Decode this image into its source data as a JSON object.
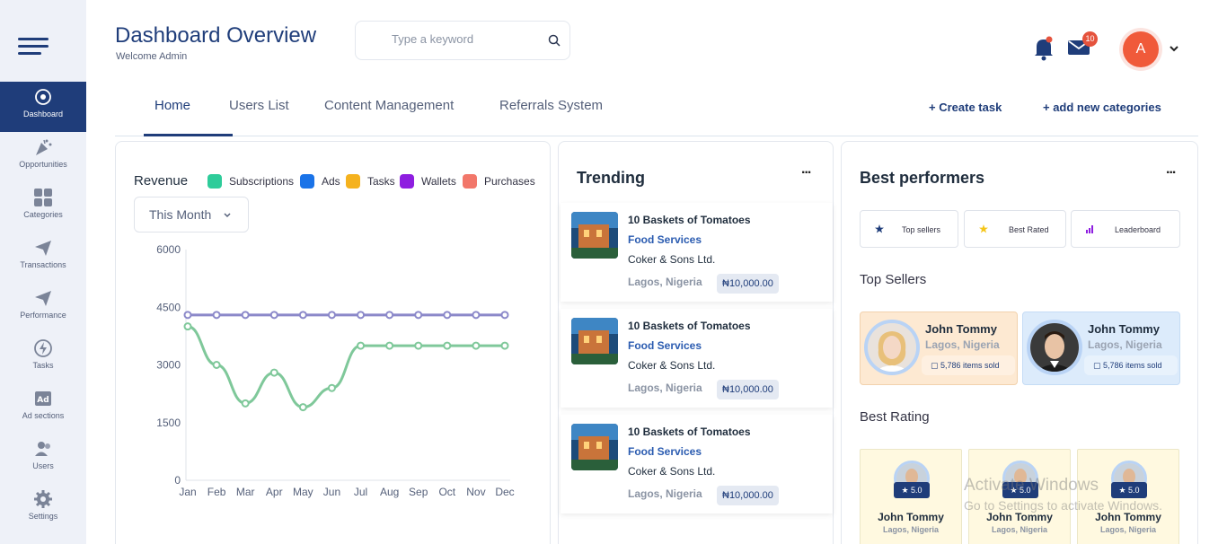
{
  "header": {
    "title": "Dashboard Overview",
    "subtitle": "Welcome Admin"
  },
  "search": {
    "placeholder": "Type a keyword"
  },
  "notifications": {
    "mail_count": "10"
  },
  "user": {
    "initial": "A"
  },
  "sidebar": {
    "items": [
      {
        "label": "Dashboard",
        "icon": "target-icon",
        "active": true
      },
      {
        "label": "Opportunities",
        "icon": "party-popper-icon"
      },
      {
        "label": "Categories",
        "icon": "grid-icon"
      },
      {
        "label": "Transactions",
        "icon": "send-icon"
      },
      {
        "label": "Performance",
        "icon": "send-icon"
      },
      {
        "label": "Tasks",
        "icon": "lightning-icon"
      },
      {
        "label": "Ad sections",
        "icon": "ad-icon"
      },
      {
        "label": "Users",
        "icon": "users-icon"
      },
      {
        "label": "Settings",
        "icon": "gear-icon"
      }
    ]
  },
  "tabs": [
    {
      "label": "Home",
      "active": true
    },
    {
      "label": "Users List"
    },
    {
      "label": "Content Management"
    },
    {
      "label": "Referrals System"
    }
  ],
  "actions": {
    "create_task": "+ Create task",
    "add_categories": "+ add new categories"
  },
  "revenue": {
    "title": "Revenue",
    "filter": "This Month",
    "legend": [
      {
        "name": "Subscriptions",
        "color": "#2ecc9a"
      },
      {
        "name": "Ads",
        "color": "#1a73e8"
      },
      {
        "name": "Tasks",
        "color": "#f5b21e"
      },
      {
        "name": "Wallets",
        "color": "#8e1ee0"
      },
      {
        "name": "Purchases",
        "color": "#f2776a"
      }
    ]
  },
  "chart_data": {
    "type": "line",
    "categories": [
      "Jan",
      "Feb",
      "Mar",
      "Apr",
      "May",
      "Jun",
      "Jul",
      "Aug",
      "Sep",
      "Oct",
      "Nov",
      "Dec"
    ],
    "yticks": [
      "6000",
      "4500",
      "3000",
      "1500",
      "0"
    ],
    "ylim": [
      0,
      6000
    ],
    "series": [
      {
        "color": "#8b88c9",
        "values": [
          4300,
          4300,
          4300,
          4300,
          4300,
          4300,
          4300,
          4300,
          4300,
          4300,
          4300,
          4300
        ]
      },
      {
        "color": "#7fc89a",
        "values": [
          4000,
          3000,
          2000,
          2800,
          1900,
          2400,
          3500,
          3500,
          3500,
          3500,
          3500,
          3500
        ]
      }
    ]
  },
  "trending": {
    "title": "Trending",
    "more": "...",
    "items": [
      {
        "name": "10 Baskets of Tomatoes",
        "category": "Food Services",
        "seller": "Coker & Sons Ltd.",
        "location": "Lagos, Nigeria",
        "price": "₦10,000.00"
      },
      {
        "name": "10 Baskets of Tomatoes",
        "category": "Food Services",
        "seller": "Coker & Sons Ltd.",
        "location": "Lagos, Nigeria",
        "price": "₦10,000.00"
      },
      {
        "name": "10 Baskets of Tomatoes",
        "category": "Food Services",
        "seller": "Coker & Sons Ltd.",
        "location": "Lagos, Nigeria",
        "price": "₦10,000.00"
      }
    ]
  },
  "best": {
    "title": "Best performers",
    "more": "...",
    "filters": [
      {
        "label": "Top sellers",
        "icon": "star-icon",
        "color": "#1f3d7a"
      },
      {
        "label": "Best Rated",
        "icon": "star-icon",
        "color": "#f5c518"
      },
      {
        "label": "Leaderboard",
        "icon": "bar-chart-icon",
        "color": "#8e1ee0"
      }
    ],
    "top_sellers_title": "Top Sellers",
    "top_sellers": [
      {
        "name": "John Tommy",
        "location": "Lagos, Nigeria",
        "sold": "5,786 items sold",
        "bg": "#fde9d2"
      },
      {
        "name": "John Tommy",
        "location": "Lagos, Nigeria",
        "sold": "5,786 items sold",
        "bg": "#dcebfb"
      }
    ],
    "best_rating_title": "Best Rating",
    "best_rating": [
      {
        "name": "John Tommy",
        "location": "Lagos, Nigeria",
        "rating": "★ 5.0"
      },
      {
        "name": "John Tommy",
        "location": "Lagos, Nigeria",
        "rating": "★ 5.0"
      },
      {
        "name": "John Tommy",
        "location": "Lagos, Nigeria",
        "rating": "★ 5.0"
      }
    ]
  },
  "watermark": {
    "line1": "Activate Windows",
    "line2": "Go to Settings to activate Windows."
  }
}
